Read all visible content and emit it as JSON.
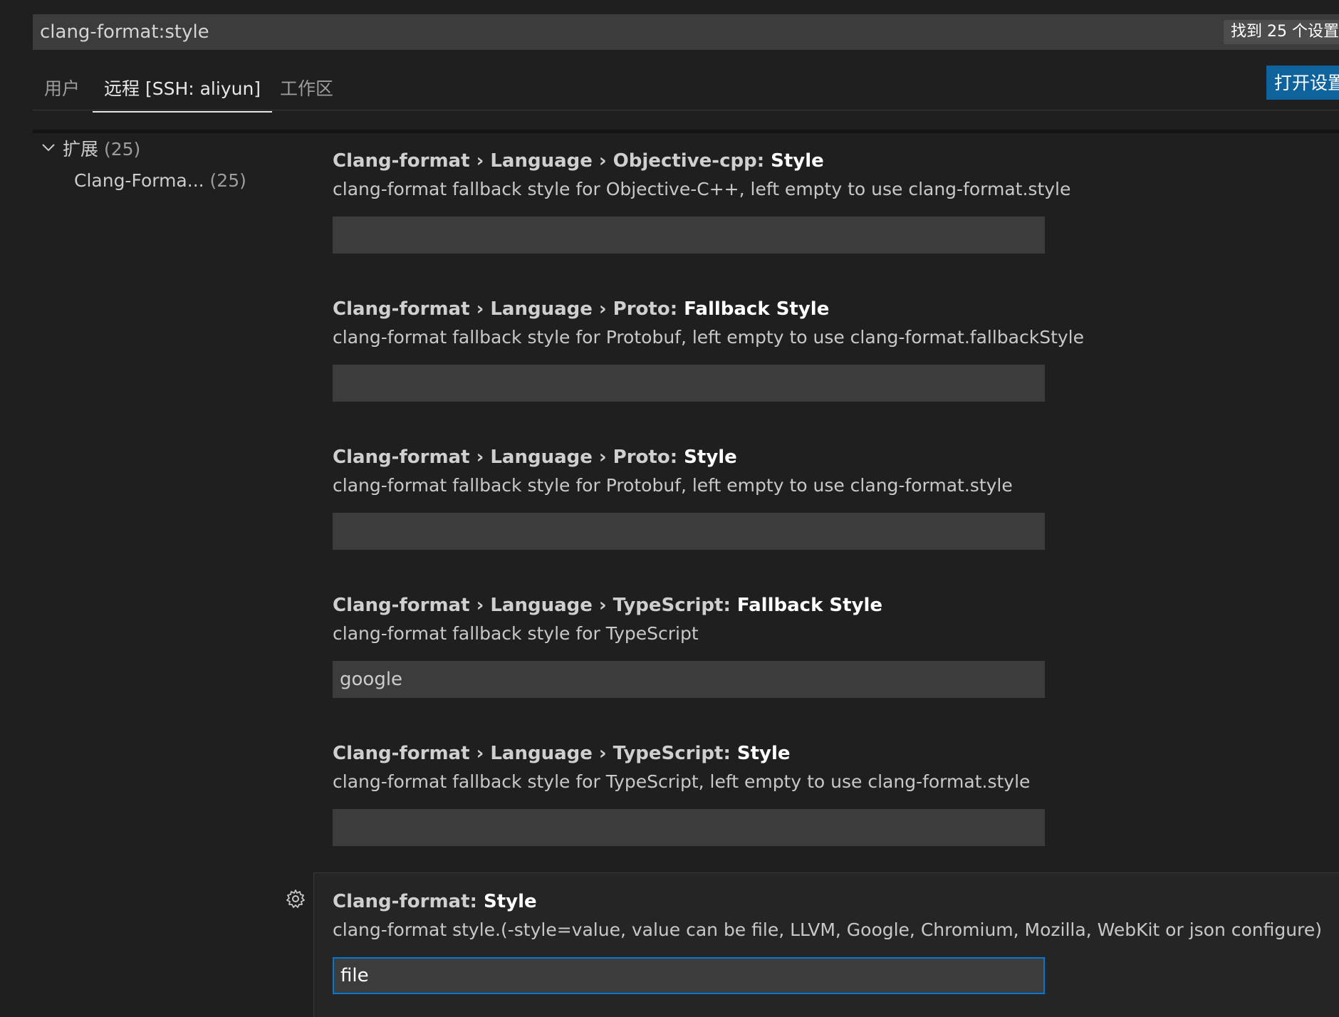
{
  "search": {
    "value": "clang-format:style",
    "result_count": "找到 25 个设置"
  },
  "tabs": [
    {
      "label": "用户"
    },
    {
      "label": "远程 [SSH: aliyun]"
    },
    {
      "label": "工作区"
    }
  ],
  "open_settings_label": "打开设置",
  "tree": {
    "group_label": "扩展",
    "group_count": "(25)",
    "child_label": "Clang-Forma...",
    "child_count": "(25)"
  },
  "settings": [
    {
      "prefix": "Clang-format › Language › Objective-cpp: ",
      "leaf": "Style",
      "description": "clang-format fallback style for Objective-C++, left empty to use clang-format.style",
      "value": ""
    },
    {
      "prefix": "Clang-format › Language › Proto: ",
      "leaf": "Fallback Style",
      "description": "clang-format fallback style for Protobuf, left empty to use clang-format.fallbackStyle",
      "value": ""
    },
    {
      "prefix": "Clang-format › Language › Proto: ",
      "leaf": "Style",
      "description": "clang-format fallback style for Protobuf, left empty to use clang-format.style",
      "value": ""
    },
    {
      "prefix": "Clang-format › Language › TypeScript: ",
      "leaf": "Fallback Style",
      "description": "clang-format fallback style for TypeScript",
      "value": "google"
    },
    {
      "prefix": "Clang-format › Language › TypeScript: ",
      "leaf": "Style",
      "description": "clang-format fallback style for TypeScript, left empty to use clang-format.style",
      "value": ""
    },
    {
      "prefix": "Clang-format: ",
      "leaf": "Style",
      "description": "clang-format style.(-style=value, value can be file, LLVM, Google, Chromium, Mozilla, WebKit or json configure)",
      "value": "file"
    }
  ],
  "colors": {
    "accent": "#0e639c",
    "focus_border": "#0078d4",
    "background": "#1f1f1f",
    "input_background": "#3c3c3c"
  },
  "icons": {
    "tree_chevron": "chevron-down-icon",
    "setting_gear": "gear-icon"
  }
}
